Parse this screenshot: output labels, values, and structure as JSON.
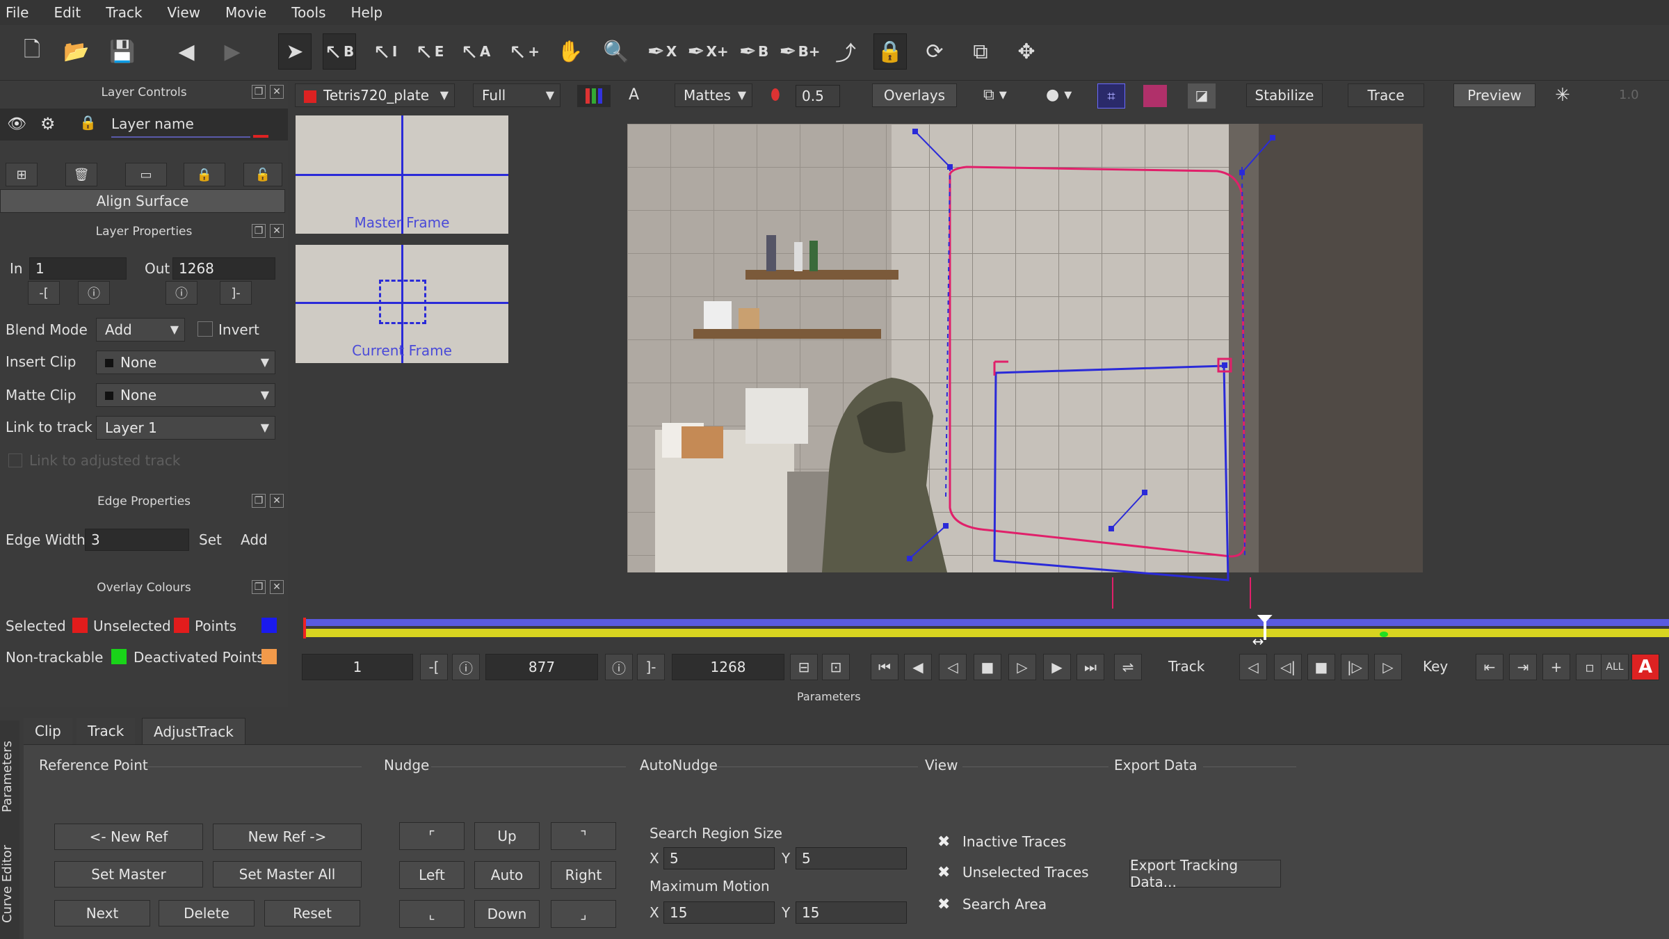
{
  "menu": [
    "File",
    "Edit",
    "Track",
    "View",
    "Movie",
    "Tools",
    "Help"
  ],
  "layer_controls": {
    "title": "Layer Controls",
    "layer_name": "Layer name",
    "align_surface": "Align Surface"
  },
  "layer_properties": {
    "title": "Layer Properties",
    "in_label": "In",
    "in_value": "1",
    "out_label": "Out",
    "out_value": "1268",
    "blend_mode_label": "Blend Mode",
    "blend_mode_value": "Add",
    "invert_label": "Invert",
    "insert_clip_label": "Insert Clip",
    "insert_clip_value": "None",
    "matte_clip_label": "Matte Clip",
    "matte_clip_value": "None",
    "link_to_track_label": "Link to track",
    "link_to_track_value": "Layer 1",
    "link_adjusted_label": "Link to adjusted track"
  },
  "edge_properties": {
    "title": "Edge Properties",
    "edge_width_label": "Edge Width",
    "edge_width_value": "3",
    "set_label": "Set",
    "add_label": "Add"
  },
  "overlay_colours": {
    "title": "Overlay Colours",
    "selected": "Selected",
    "unselected": "Unselected",
    "points": "Points",
    "non_trackable": "Non-trackable",
    "deactivated_points": "Deactivated Points",
    "selected_color": "#e21c1c",
    "unselected_color": "#e21c1c",
    "points_color": "#1a1aee",
    "non_trackable_color": "#19d419",
    "deactivated_color": "#f29a4a"
  },
  "viewer": {
    "clip_name": "Tetris720_plate",
    "resolution": "Full",
    "a_label": "A",
    "mattes": "Mattes",
    "opacity": "0.5",
    "overlays": "Overlays",
    "stabilize": "Stabilize",
    "trace": "Trace",
    "preview": "Preview",
    "zoom": "1.0"
  },
  "thumbnails": {
    "master": "Master Frame",
    "current": "Current Frame"
  },
  "transport": {
    "start_frame": "1",
    "current_frame": "877",
    "end_frame": "1268",
    "track_label": "Track",
    "key_label": "Key",
    "all_label": "ALL",
    "auto_key_label": "A"
  },
  "timeline": {
    "playhead_fraction": 0.704,
    "keyframe_fraction": 0.791
  },
  "parameters": {
    "title": "Parameters",
    "side_tabs": [
      "Parameters",
      "Curve Editor"
    ],
    "tabs": [
      "Clip",
      "Track",
      "AdjustTrack"
    ],
    "active_tab": "AdjustTrack",
    "reference_point": {
      "title": "Reference Point",
      "new_ref_left": "<- New Ref",
      "new_ref_right": "New Ref ->",
      "set_master": "Set Master",
      "set_master_all": "Set Master All",
      "next": "Next",
      "delete": "Delete",
      "reset": "Reset"
    },
    "nudge": {
      "title": "Nudge",
      "up": "Up",
      "left": "Left",
      "auto": "Auto",
      "right": "Right",
      "down": "Down"
    },
    "autonudge": {
      "title": "AutoNudge",
      "search_region_label": "Search Region Size",
      "x_label": "X",
      "y_label": "Y",
      "search_x": "5",
      "search_y": "5",
      "max_motion_label": "Maximum Motion",
      "max_x": "15",
      "max_y": "15"
    },
    "view": {
      "title": "View",
      "inactive_traces": "Inactive Traces",
      "unselected_traces": "Unselected Traces",
      "search_area": "Search Area"
    },
    "export_data": {
      "title": "Export Data",
      "button": "Export Tracking Data..."
    }
  }
}
